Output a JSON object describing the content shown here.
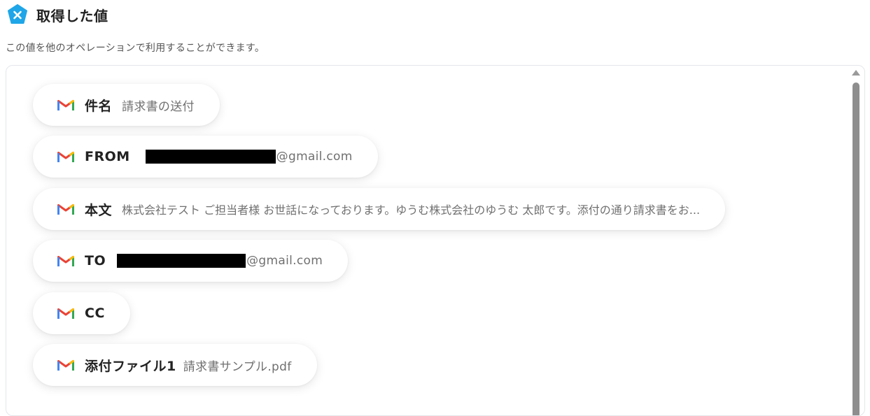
{
  "header": {
    "title": "取得した値",
    "description": "この値を他のオペレーションで利用することができます。"
  },
  "fields": [
    {
      "label": "件名",
      "value": "請求書の送付"
    },
    {
      "label": "FROM",
      "value": "@gmail.com",
      "redacted_prefix": true
    },
    {
      "label": "本文",
      "value": "株式会社テスト ご担当者様 お世話になっております。ゆうむ株式会社のゆうむ 太郎です。添付の通り請求書をお..."
    },
    {
      "label": "TO",
      "value": "@gmail.com",
      "redacted_prefix": true
    },
    {
      "label": "CC",
      "value": ""
    },
    {
      "label": "添付ファイル1",
      "value": "請求書サンプル.pdf"
    }
  ],
  "icons": {
    "header": "yoom-logo-icon",
    "field": "gmail-icon"
  },
  "colors": {
    "logo_blue": "#1fa6e8",
    "gmail_red": "#ea4335",
    "gmail_blue": "#4285f4",
    "gmail_green": "#34a853",
    "gmail_yellow": "#fbbc04"
  }
}
